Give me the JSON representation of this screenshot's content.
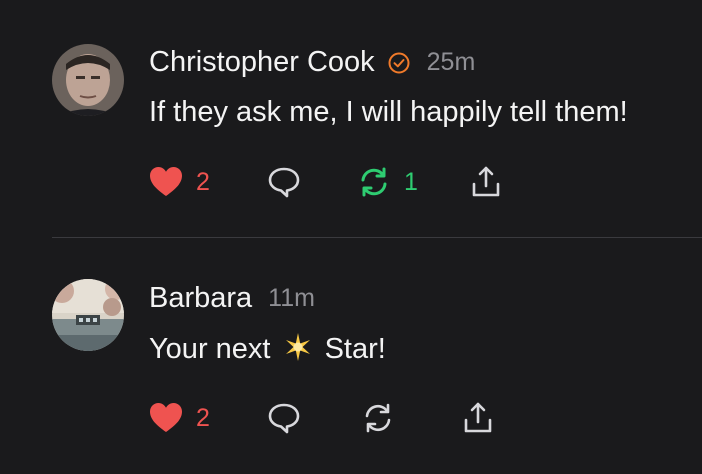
{
  "posts": [
    {
      "author": "Christopher Cook",
      "verified": true,
      "time": "25m",
      "text": "If they ask me, I will happily tell them!",
      "likes": "2",
      "reposts": "1",
      "liked": true,
      "reposted": true
    },
    {
      "author": "Barbara",
      "verified": false,
      "time": "11m",
      "text_before": "Your next",
      "text_after": "Star!",
      "likes": "2",
      "liked": true,
      "reposted": false
    }
  ],
  "colors": {
    "background": "#1a1a1c",
    "like": "#ef5350",
    "repost": "#2ecc71",
    "verified": "#f07a2a",
    "muted": "#8f8f94",
    "icon": "#d8d8dc"
  },
  "icons": [
    "heart-icon",
    "comment-icon",
    "repost-icon",
    "share-icon",
    "verified-badge-icon",
    "star-emoji"
  ]
}
